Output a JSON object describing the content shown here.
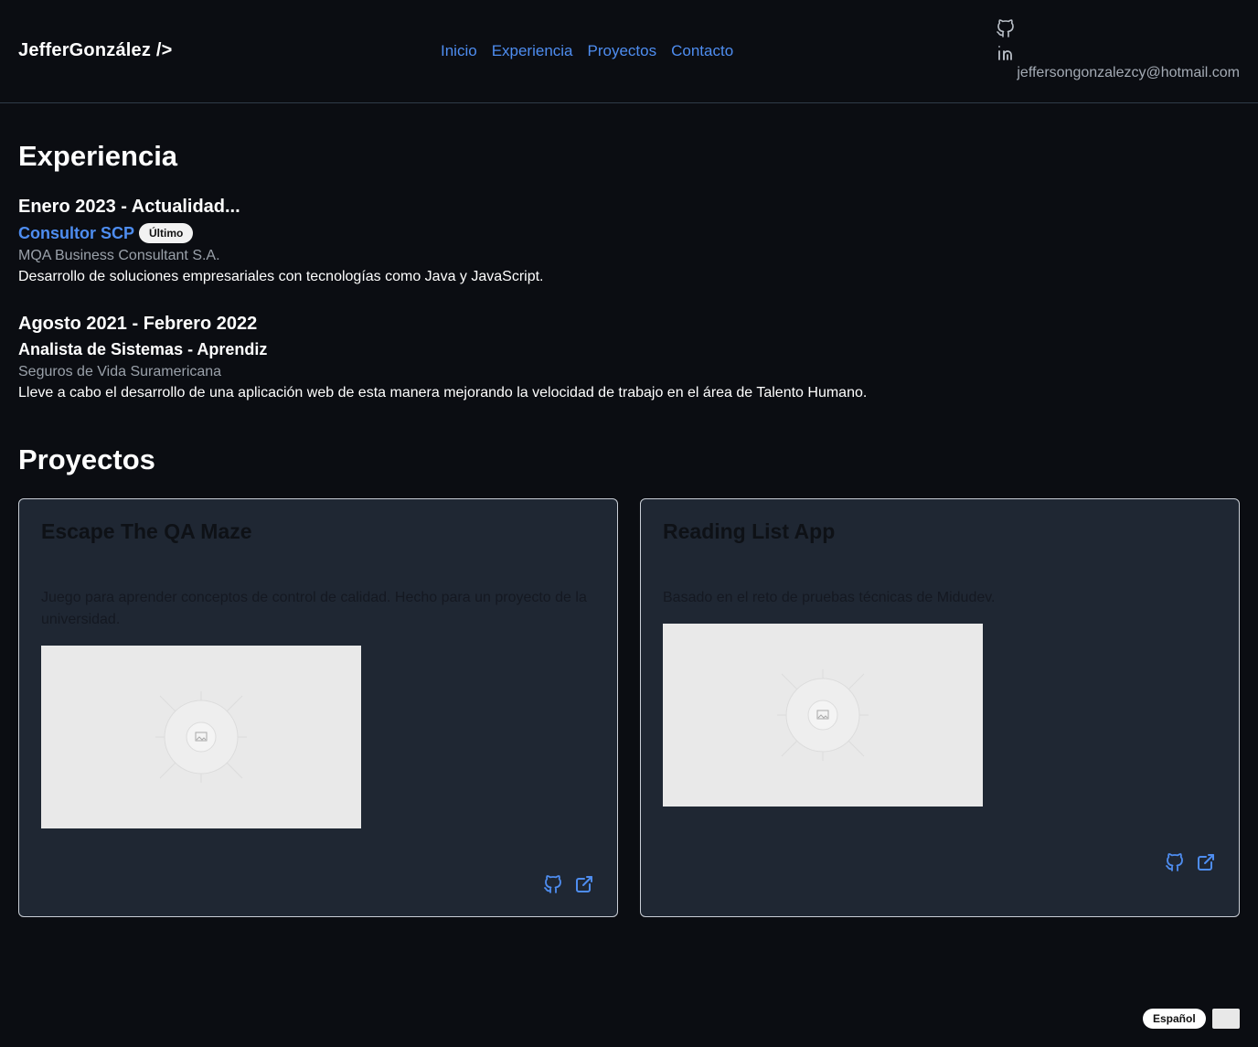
{
  "header": {
    "brand": "JefferGonzález />",
    "nav": [
      "Inicio",
      "Experiencia",
      "Proyectos",
      "Contacto"
    ],
    "social_icons": [
      "github-icon",
      "linkedin-icon"
    ],
    "email": "jeffersongonzalezcy@hotmail.com"
  },
  "experience": {
    "title": "Experiencia",
    "items": [
      {
        "date": "Enero 2023 - Actualidad...",
        "role": "Consultor SCP",
        "badge": "Último",
        "company": "MQA Business Consultant S.A.",
        "description": "Desarrollo de soluciones empresariales con tecnologías como Java y JavaScript."
      },
      {
        "date": "Agosto 2021 - Febrero 2022",
        "role": "Analista de Sistemas - Aprendiz",
        "company": "Seguros de Vida Suramericana",
        "description": "Lleve a cabo el desarrollo de una aplicación web de esta manera mejorando la velocidad de trabajo en el área de Talento Humano."
      }
    ]
  },
  "projects": {
    "title": "Proyectos",
    "items": [
      {
        "name": "Escape The QA Maze",
        "description": "Juego para aprender conceptos de control de calidad. Hecho para un proyecto de la universidad."
      },
      {
        "name": "Reading List App",
        "description": "Basado en el reto de pruebas técnicas de Midudev."
      }
    ]
  },
  "footer": {
    "language": "Español"
  },
  "colors": {
    "background": "#0b0d12",
    "accent": "#4e8df0",
    "card": "#1f2733"
  }
}
